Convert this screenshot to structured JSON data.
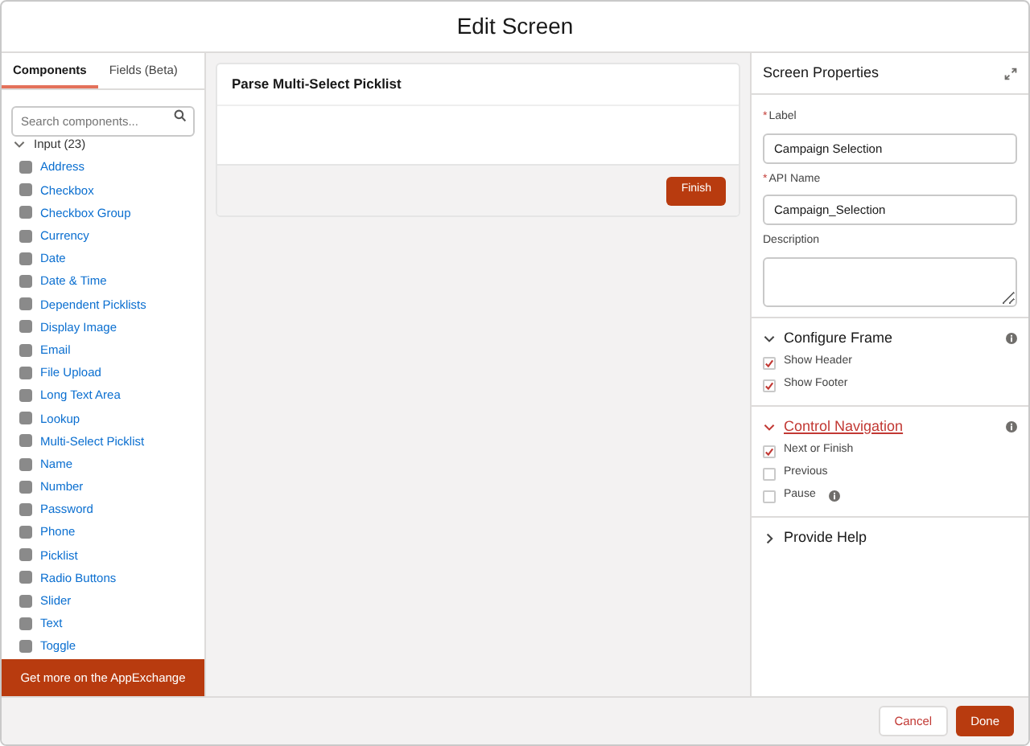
{
  "window": {
    "title": "Edit Screen"
  },
  "tabs": [
    {
      "label": "Components",
      "selected": true
    },
    {
      "label": "Fields (Beta)",
      "selected": false
    }
  ],
  "search": {
    "placeholder": "Search components..."
  },
  "component_group": {
    "label": "Input (23)",
    "expanded": true,
    "items": [
      "Address",
      "Checkbox",
      "Checkbox Group",
      "Currency",
      "Date",
      "Date & Time",
      "Dependent Picklists",
      "Display Image",
      "Email",
      "File Upload",
      "Long Text Area",
      "Lookup",
      "Multi-Select Picklist",
      "Name",
      "Number",
      "Password",
      "Phone",
      "Picklist",
      "Radio Buttons",
      "Slider",
      "Text",
      "Toggle"
    ]
  },
  "appexchange_button": "Get more on the AppExchange",
  "canvas": {
    "screen_title": "Parse Multi-Select Picklist",
    "finish_button": "Finish"
  },
  "properties": {
    "title": "Screen Properties",
    "fields": [
      {
        "required_mark": "*",
        "label": "Label",
        "value": "Campaign Selection",
        "kind": "input"
      },
      {
        "required_mark": "*",
        "label": "API Name",
        "value": "Campaign_Selection",
        "kind": "input"
      },
      {
        "label": "Description",
        "kind": "textarea"
      }
    ],
    "sections": [
      {
        "title": "Configure Frame",
        "expanded": true,
        "highlighted": false,
        "info": true,
        "options": [
          {
            "label": "Show Header",
            "checked": true,
            "info": false
          },
          {
            "label": "Show Footer",
            "checked": true,
            "info": false
          }
        ]
      },
      {
        "title": "Control Navigation",
        "expanded": true,
        "highlighted": true,
        "info": true,
        "options": [
          {
            "label": "Next or Finish",
            "checked": true,
            "info": false
          },
          {
            "label": "Previous",
            "checked": false,
            "info": false
          },
          {
            "label": "Pause",
            "checked": false,
            "info": true
          }
        ]
      },
      {
        "title": "Provide Help",
        "expanded": false,
        "highlighted": false,
        "info": false
      }
    ]
  },
  "footer_buttons": [
    {
      "label": "Cancel",
      "kind": "secondary"
    },
    {
      "label": "Done",
      "kind": "primary"
    }
  ]
}
